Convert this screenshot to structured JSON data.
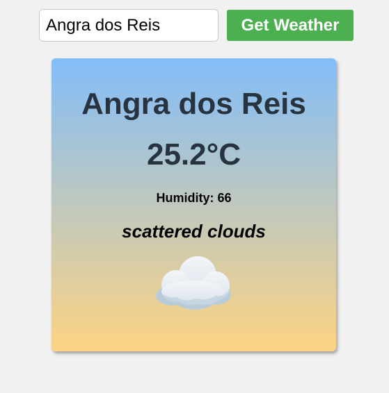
{
  "search": {
    "value": "Angra dos Reis",
    "button_label": "Get Weather"
  },
  "weather": {
    "city": "Angra dos Reis",
    "temperature": "25.2°C",
    "humidity": "Humidity: 66",
    "description": "scattered clouds",
    "icon": "cloud-icon"
  },
  "colors": {
    "button": "#4caf50",
    "card_gradient_top": "#82bdf9",
    "card_gradient_bottom": "#fdd383"
  }
}
